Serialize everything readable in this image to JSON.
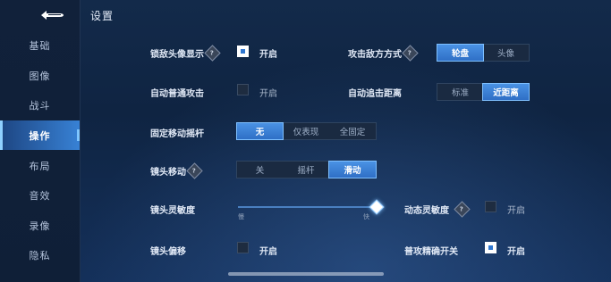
{
  "page": {
    "title": "设置"
  },
  "sidebar": {
    "items": [
      {
        "label": "基础"
      },
      {
        "label": "图像"
      },
      {
        "label": "战斗"
      },
      {
        "label": "操作"
      },
      {
        "label": "布局"
      },
      {
        "label": "音效"
      },
      {
        "label": "录像"
      },
      {
        "label": "隐私"
      }
    ],
    "active_index": 3
  },
  "settings": {
    "lock_avatar": {
      "label": "锁敌头像显示",
      "state_label": "开启",
      "checked": true
    },
    "attack_mode": {
      "label": "攻击敌方方式",
      "options": [
        "轮盘",
        "头像"
      ],
      "selected": "轮盘"
    },
    "auto_attack": {
      "label": "自动普通攻击",
      "state_label": "开启",
      "checked": false
    },
    "auto_chase": {
      "label": "自动追击距离",
      "options": [
        "标准",
        "近距离"
      ],
      "selected": "近距离"
    },
    "fixed_joystick": {
      "label": "固定移动摇杆",
      "options": [
        "无",
        "仅表现",
        "全固定"
      ],
      "selected": "无"
    },
    "camera_move": {
      "label": "镜头移动",
      "options": [
        "关",
        "摇杆",
        "滑动"
      ],
      "selected": "滑动"
    },
    "camera_sensitivity": {
      "label": "镜头灵敏度",
      "min_label": "慢",
      "max_label": "快",
      "value": 1.0
    },
    "dynamic_sensitivity": {
      "label": "动态灵敏度",
      "state_label": "开启",
      "checked": false
    },
    "camera_offset": {
      "label": "镜头偏移",
      "state_label": "开启",
      "checked": false
    },
    "precise_attack": {
      "label": "普攻精确开关",
      "state_label": "开启",
      "checked": true
    }
  },
  "colors": {
    "accent": "#3b82d6",
    "active_nav": "#3c8ce6",
    "background": "#132a4a"
  }
}
